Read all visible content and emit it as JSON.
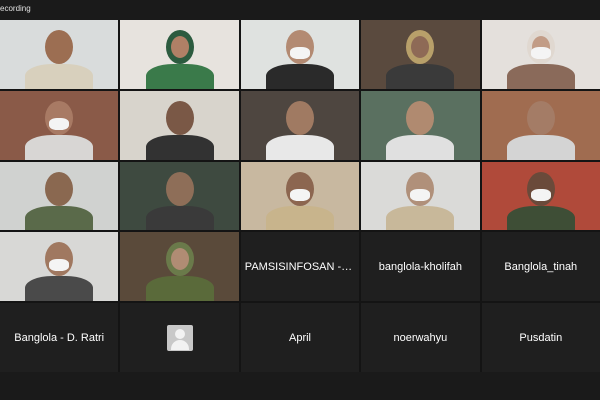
{
  "topbar": {
    "recording_label": "ecording"
  },
  "grid": {
    "rows": [
      [
        {
          "type": "video",
          "bg": "#d9dcdc",
          "skin": "#9c6e52",
          "shirt": "#d8d0bd"
        },
        {
          "type": "video",
          "bg": "#e7e3de",
          "skin": "#b08066",
          "shirt": "#3a7a4a",
          "hijab": "#2c5b3f"
        },
        {
          "type": "video",
          "bg": "#dfe2e0",
          "skin": "#b38a72",
          "shirt": "#2a2a2a",
          "mask": true
        },
        {
          "type": "video",
          "bg": "#5a4a3e",
          "skin": "#8e6a56",
          "shirt": "#3a3a3a",
          "hijab": "#b8a06a"
        },
        {
          "type": "video",
          "bg": "#e4e0dc",
          "skin": "#c29c86",
          "shirt": "#8a6a5a",
          "hijab": "#e0d8d0",
          "mask": true
        }
      ],
      [
        {
          "type": "video",
          "bg": "#8a5a48",
          "skin": "#a87a64",
          "shirt": "#d8d6d4",
          "mask": true
        },
        {
          "type": "video",
          "bg": "#d8d4cc",
          "skin": "#7a5846",
          "shirt": "#323232"
        },
        {
          "type": "video",
          "bg": "#4e4640",
          "skin": "#a07a62",
          "shirt": "#e8e8e8"
        },
        {
          "type": "video",
          "bg": "#5a7060",
          "skin": "#b08a70",
          "shirt": "#e0e0e0"
        },
        {
          "type": "video",
          "bg": "#a06c50",
          "skin": "#a47c66",
          "shirt": "#d4d4d4"
        }
      ],
      [
        {
          "type": "video",
          "bg": "#d0d2d0",
          "skin": "#8a6850",
          "shirt": "#5a6a4a"
        },
        {
          "type": "video",
          "bg": "#3e4a40",
          "skin": "#8e6e58",
          "shirt": "#3a3a3a"
        },
        {
          "type": "video",
          "bg": "#c8b8a0",
          "skin": "#8c6650",
          "shirt": "#c8b48c",
          "mask": true
        },
        {
          "type": "video",
          "bg": "#dadad8",
          "skin": "#b0907a",
          "shirt": "#c8b89a",
          "mask": true
        },
        {
          "type": "video",
          "bg": "#b04a3a",
          "skin": "#6a4a3a",
          "shirt": "#3e4e36",
          "mask": true
        }
      ],
      [
        {
          "type": "video",
          "bg": "#d8d8d6",
          "skin": "#a07860",
          "shirt": "#4a4a4a",
          "mask": true
        },
        {
          "type": "video",
          "bg": "#5a4a3a",
          "skin": "#b08c74",
          "shirt": "#5a6a3a",
          "hijab": "#6a7a4a"
        },
        {
          "type": "name",
          "label": "PAMSISINFOSAN - KASA L..."
        },
        {
          "type": "name",
          "label": "banglola-kholifah"
        },
        {
          "type": "name",
          "label": "Banglola_tinah"
        }
      ],
      [
        {
          "type": "name",
          "label": "Banglola - D. Ratri"
        },
        {
          "type": "avatar"
        },
        {
          "type": "name",
          "label": "April"
        },
        {
          "type": "name",
          "label": "noerwahyu"
        },
        {
          "type": "name",
          "label": "Pusdatin"
        }
      ]
    ]
  }
}
